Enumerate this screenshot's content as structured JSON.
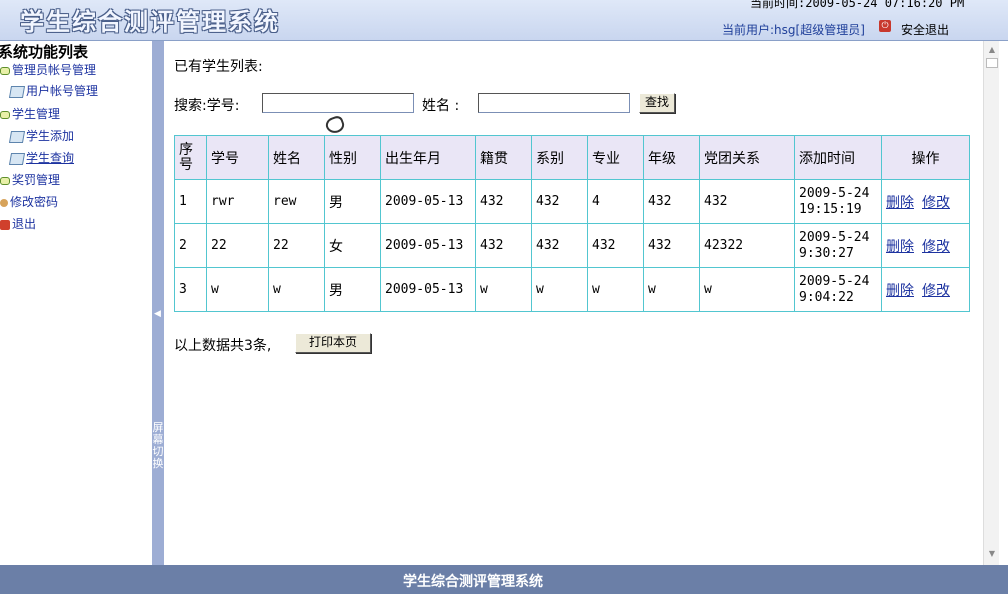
{
  "header": {
    "title": "学生综合测评管理系统",
    "current_time": "当前时间:2009-05-24 07:16:20 PM",
    "current_user": "当前用户:hsg[超级管理员]",
    "logout": "安全退出"
  },
  "sidebar": {
    "title": "系统功能列表",
    "items": [
      {
        "label": "管理员帐号管理",
        "type": "group"
      },
      {
        "label": "用户帐号管理",
        "type": "leaf"
      },
      {
        "label": "学生管理",
        "type": "group"
      },
      {
        "label": "学生添加",
        "type": "leaf"
      },
      {
        "label": "学生查询",
        "type": "leaf"
      },
      {
        "label": "奖罚管理",
        "type": "group"
      },
      {
        "label": "修改密码",
        "type": "key"
      },
      {
        "label": "退出",
        "type": "exit"
      }
    ]
  },
  "splitter": {
    "arrow": "◀",
    "label": "屏幕切换"
  },
  "main": {
    "heading": "已有学生列表:",
    "search": {
      "label_id": "搜索:学号:",
      "label_name": "姓名 :",
      "id_value": "",
      "name_value": "",
      "button": "查找"
    },
    "table": {
      "headers": [
        "序号",
        "学号",
        "姓名",
        "性别",
        "出生年月",
        "籍贯",
        "系别",
        "专业",
        "年级",
        "党团关系",
        "添加时间",
        "操作"
      ],
      "rows": [
        {
          "seq": "1",
          "id": "rwr",
          "name": "rew",
          "sex": "男",
          "birth": "2009-05-13",
          "origin": "432",
          "dept": "432",
          "major": "4",
          "grade": "432",
          "party": "432",
          "date": "2009-5-24",
          "time": "19:15:19"
        },
        {
          "seq": "2",
          "id": "22",
          "name": "22",
          "sex": "女",
          "birth": "2009-05-13",
          "origin": "432",
          "dept": "432",
          "major": "432",
          "grade": "432",
          "party": "42322",
          "date": "2009-5-24",
          "time": "9:30:27"
        },
        {
          "seq": "3",
          "id": "w",
          "name": "w",
          "sex": "男",
          "birth": "2009-05-13",
          "origin": "w",
          "dept": "w",
          "major": "w",
          "grade": "w",
          "party": "w",
          "date": "2009-5-24",
          "time": "9:04:22"
        }
      ],
      "delete_label": "删除",
      "edit_label": "修改"
    },
    "count_text": "以上数据共3条,",
    "print_button": "打印本页"
  },
  "footer": {
    "title": "学生综合测评管理系统"
  }
}
